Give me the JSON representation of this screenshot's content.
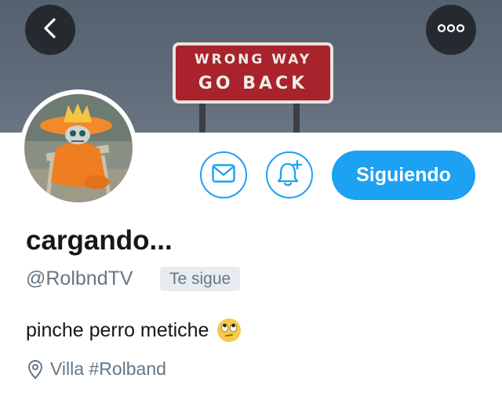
{
  "header": {
    "banner_sign": {
      "line1": "WRONG WAY",
      "line2": "GO BACK"
    },
    "back_icon": "chevron-left-icon",
    "more_icon": "more-horizontal-icon"
  },
  "profile": {
    "display_name": "cargando...",
    "handle": "@RolbndTV",
    "follows_you_label": "Te sigue",
    "bio": "pinche perro metiche",
    "bio_emoji": "eye-roll-emoji",
    "location": "Villa #Rolband"
  },
  "actions": {
    "message_icon": "envelope-icon",
    "notify_icon": "bell-plus-icon",
    "follow_label": "Siguiendo"
  },
  "colors": {
    "accent": "#1da1f2",
    "text_primary": "#14171a",
    "text_secondary": "#657786",
    "badge_bg": "#e6ecf0",
    "banner_bg": "#5f6a79",
    "sign_red": "#a8232b"
  }
}
